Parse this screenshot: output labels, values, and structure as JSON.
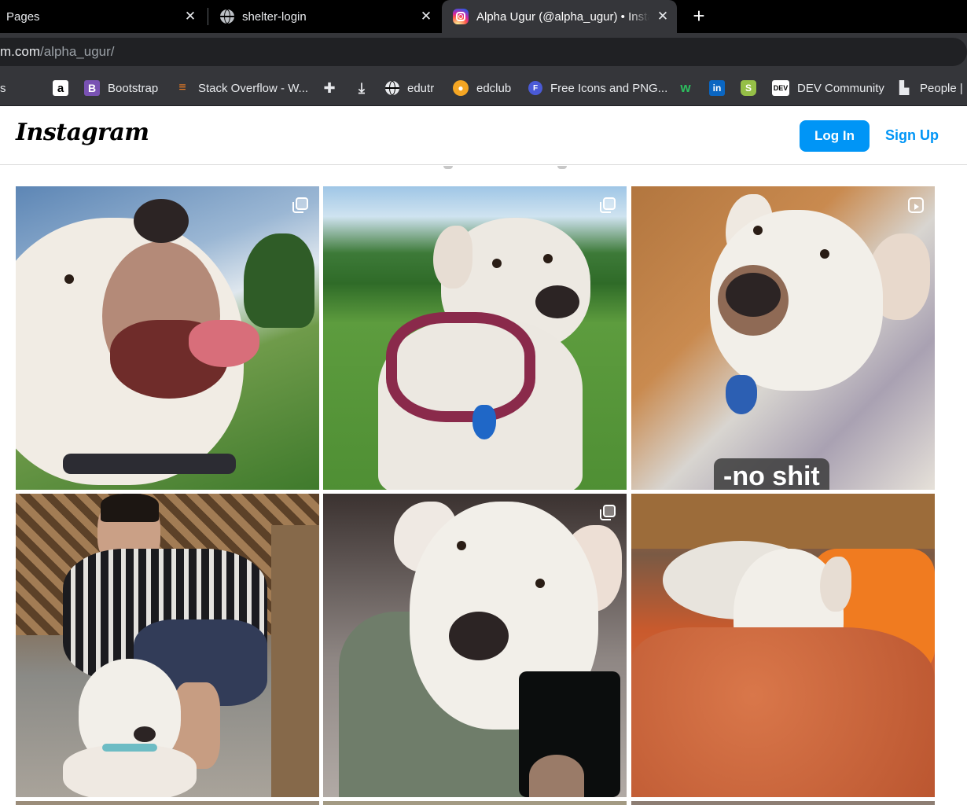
{
  "browser": {
    "tabs": [
      {
        "title": "Pages",
        "icon": "none"
      },
      {
        "title": "shelter-login",
        "icon": "globe-icon"
      },
      {
        "title": "Alpha Ugur (@alpha_ugur) • Insta",
        "icon": "instagram-icon",
        "active": true
      }
    ],
    "url": {
      "domain": "m.com",
      "path": "/alpha_ugur/"
    },
    "bookmarks": [
      {
        "label": "s"
      },
      {
        "label": "",
        "icon": "apple-icon"
      },
      {
        "label": "",
        "icon": "amazon-icon"
      },
      {
        "label": "Bootstrap",
        "icon": "bootstrap-icon"
      },
      {
        "label": "Stack Overflow - W...",
        "icon": "stackoverflow-icon"
      },
      {
        "label": "",
        "icon": "extensions-icon"
      },
      {
        "label": "",
        "icon": "download-icon"
      },
      {
        "label": "edutr",
        "icon": "globe-icon"
      },
      {
        "label": "edclub",
        "icon": "edclub-icon"
      },
      {
        "label": "Free Icons and PNG...",
        "icon": "flaticon-icon"
      },
      {
        "label": "",
        "icon": "webflow-icon"
      },
      {
        "label": "",
        "icon": "linkedin-icon"
      },
      {
        "label": "",
        "icon": "shopify-icon"
      },
      {
        "label": "DEV Community",
        "icon": "dev-icon"
      },
      {
        "label": "People | ",
        "icon": "people-icon"
      }
    ]
  },
  "instagram": {
    "logo": "Instagram",
    "login_label": "Log In",
    "signup_label": "Sign Up",
    "posts": [
      {
        "badge": "multiple-photos-icon",
        "caption": ""
      },
      {
        "badge": "multiple-photos-icon",
        "caption": ""
      },
      {
        "badge": "reel-icon",
        "caption": "-no shit"
      },
      {
        "badge": "none",
        "caption": ""
      },
      {
        "badge": "multiple-photos-icon",
        "caption": ""
      },
      {
        "badge": "none",
        "caption": ""
      }
    ]
  },
  "colors": {
    "accent": "#0095f6",
    "tab_bar": "#000000",
    "toolbar": "#35363a"
  }
}
